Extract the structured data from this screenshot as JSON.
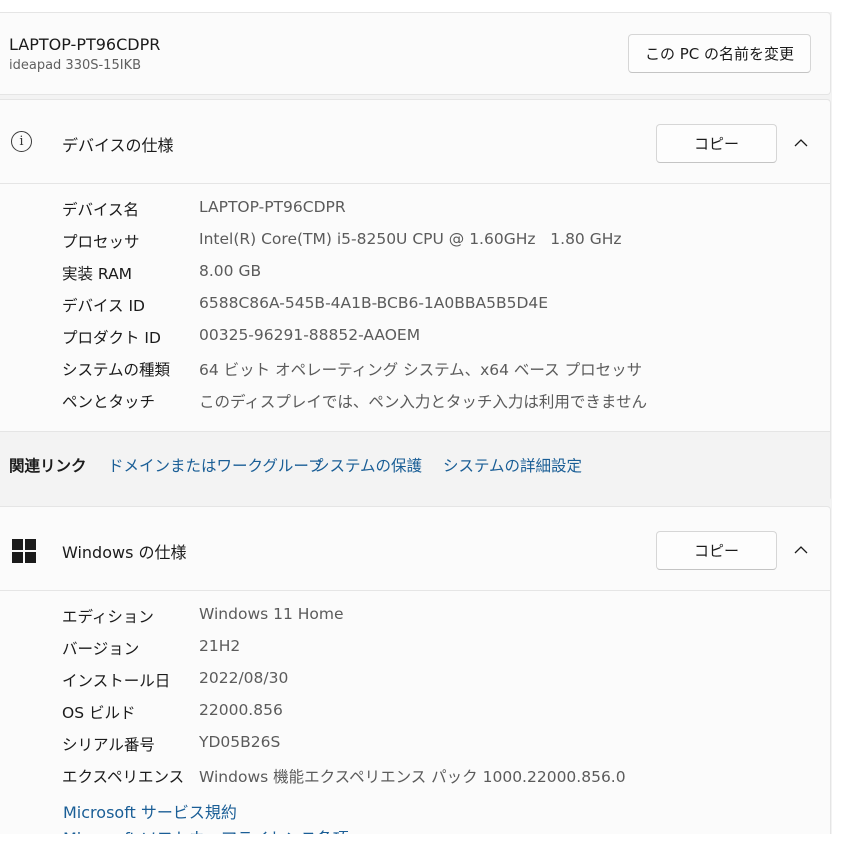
{
  "pc": {
    "name": "LAPTOP-PT96CDPR",
    "model": "ideapad 330S-15IKB",
    "rename_label": "この PC の名前を変更"
  },
  "device_spec": {
    "icon": "info-icon",
    "title": "デバイスの仕様",
    "copy_label": "コピー",
    "rows": [
      {
        "key": "デバイス名",
        "value": "LAPTOP-PT96CDPR"
      },
      {
        "key": "プロセッサ",
        "value": "Intel(R) Core(TM) i5-8250U CPU @ 1.60GHz   1.80 GHz"
      },
      {
        "key": "実装 RAM",
        "value": "8.00 GB"
      },
      {
        "key": "デバイス ID",
        "value": "6588C86A-545B-4A1B-BCB6-1A0BBA5B5D4E"
      },
      {
        "key": "プロダクト ID",
        "value": "00325-96291-88852-AAOEM"
      },
      {
        "key": "システムの種類",
        "value": "64 ビット オペレーティング システム、x64 ベース プロセッサ"
      },
      {
        "key": "ペンとタッチ",
        "value": "このディスプレイでは、ペン入力とタッチ入力は利用できません"
      }
    ]
  },
  "related": {
    "label": "関連リンク",
    "links": [
      "ドメインまたはワークグループ",
      "システムの保護",
      "システムの詳細設定"
    ]
  },
  "windows_spec": {
    "icon": "windows-logo-icon",
    "title": "Windows の仕様",
    "copy_label": "コピー",
    "rows": [
      {
        "key": "エディション",
        "value": "Windows 11 Home"
      },
      {
        "key": "バージョン",
        "value": "21H2"
      },
      {
        "key": "インストール日",
        "value": "2022/08/30"
      },
      {
        "key": "OS ビルド",
        "value": "22000.856"
      },
      {
        "key": "シリアル番号",
        "value": "YD05B26S"
      },
      {
        "key": "エクスペリエンス",
        "value": "Windows 機能エクスペリエンス パック 1000.22000.856.0"
      }
    ],
    "links": [
      "Microsoft サービス規約",
      "Microsoft ソフトウェアライセンス条項"
    ]
  },
  "colors": {
    "link": "#1a5e96",
    "card": "#fbfbfb",
    "background": "#f3f3f3"
  }
}
